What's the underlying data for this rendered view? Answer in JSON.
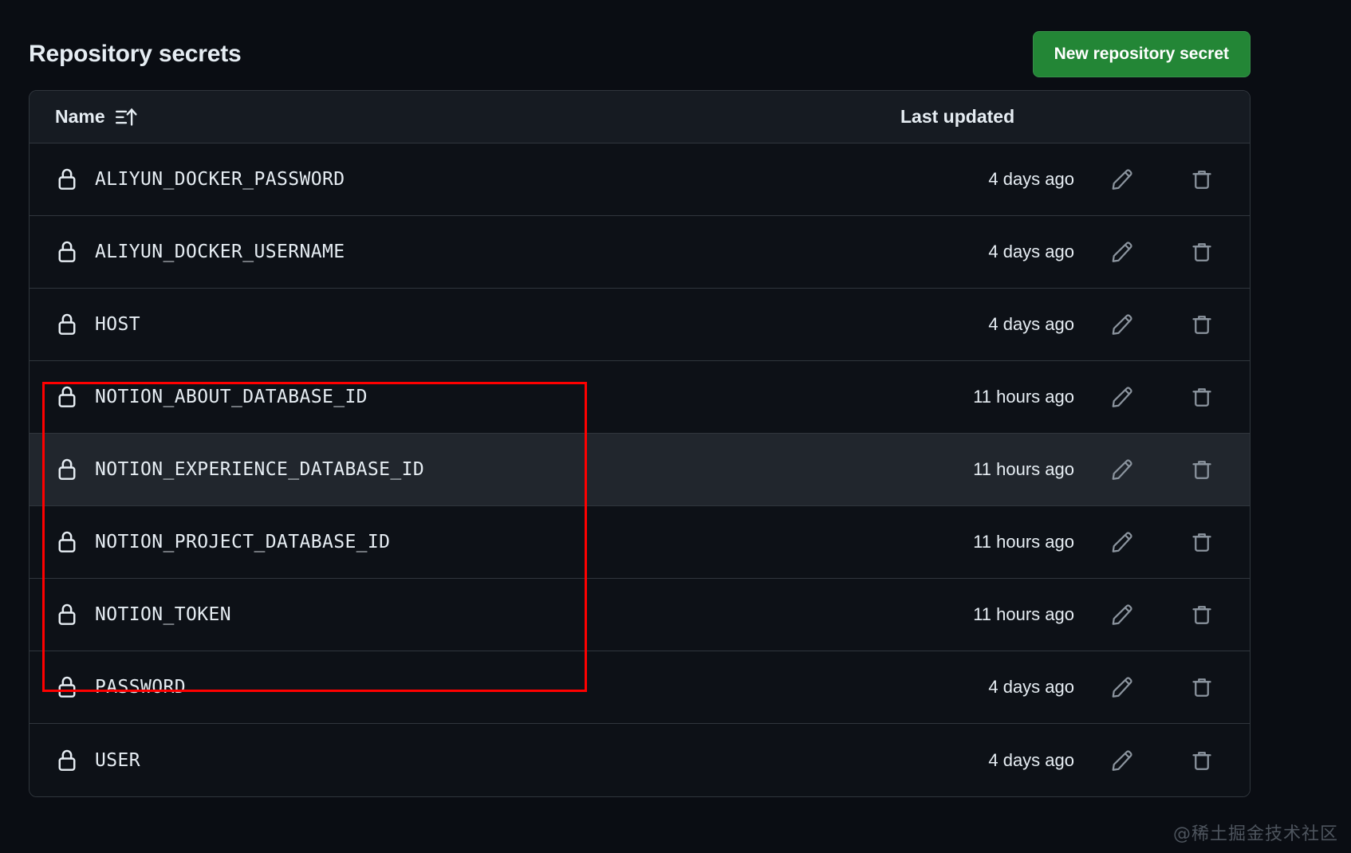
{
  "header": {
    "title": "Repository secrets",
    "new_secret_button": "New repository secret",
    "sort_icon": "sort-ascending-icon"
  },
  "table": {
    "columns": {
      "name": "Name",
      "last_updated": "Last updated"
    },
    "row_icon": "lock-icon",
    "edit_icon": "pencil-icon",
    "delete_icon": "trash-icon",
    "rows": [
      {
        "name": "ALIYUN_DOCKER_PASSWORD",
        "last_updated": "4 days ago",
        "hovered": false
      },
      {
        "name": "ALIYUN_DOCKER_USERNAME",
        "last_updated": "4 days ago",
        "hovered": false
      },
      {
        "name": "HOST",
        "last_updated": "4 days ago",
        "hovered": false
      },
      {
        "name": "NOTION_ABOUT_DATABASE_ID",
        "last_updated": "11 hours ago",
        "hovered": false
      },
      {
        "name": "NOTION_EXPERIENCE_DATABASE_ID",
        "last_updated": "11 hours ago",
        "hovered": true
      },
      {
        "name": "NOTION_PROJECT_DATABASE_ID",
        "last_updated": "11 hours ago",
        "hovered": false
      },
      {
        "name": "NOTION_TOKEN",
        "last_updated": "11 hours ago",
        "hovered": false
      },
      {
        "name": "PASSWORD",
        "last_updated": "4 days ago",
        "hovered": false
      },
      {
        "name": "USER",
        "last_updated": "4 days ago",
        "hovered": false
      }
    ]
  },
  "annotation": {
    "color": "#ff0000",
    "highlighted_rows": [
      "NOTION_ABOUT_DATABASE_ID",
      "NOTION_EXPERIENCE_DATABASE_ID",
      "NOTION_PROJECT_DATABASE_ID",
      "NOTION_TOKEN"
    ]
  },
  "watermark": {
    "text": "@稀土掘金技术社区"
  },
  "colors": {
    "page_background": "#0a0d13",
    "table_background": "#0d1117",
    "header_background": "#161b22",
    "row_hover": "#21262d",
    "border": "#30363d",
    "accent_green": "#238636",
    "text": "#e6edf3"
  }
}
